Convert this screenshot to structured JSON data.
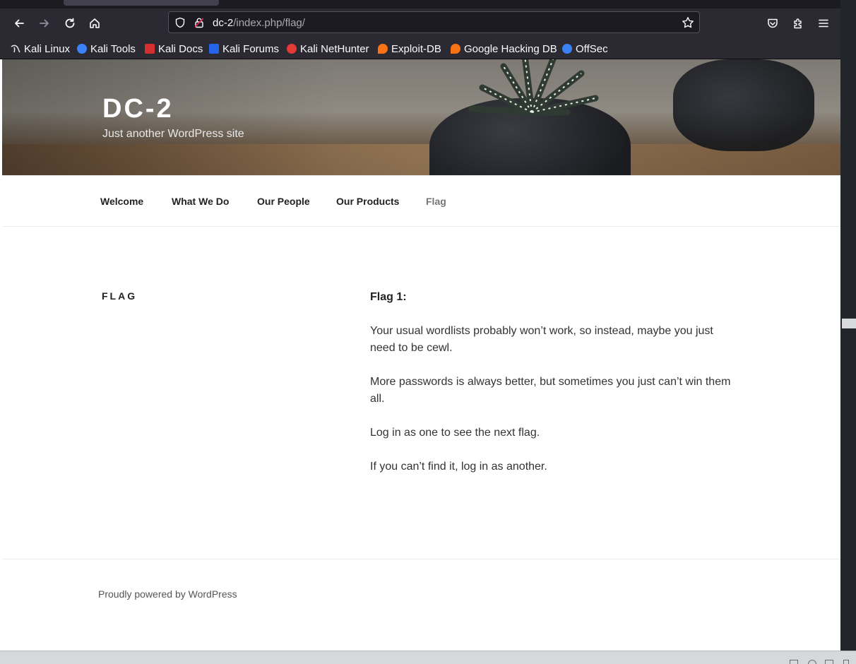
{
  "browser": {
    "url_host": "dc-2",
    "url_path": "/index.php/flag/",
    "bookmarks": [
      {
        "label": "Kali Linux",
        "icon": "kali-dragon-icon",
        "color": "#ffffff"
      },
      {
        "label": "Kali Tools",
        "icon": "kali-tools-icon",
        "color": "#3b82f6"
      },
      {
        "label": "Kali Docs",
        "icon": "kali-docs-icon",
        "color": "#d32f2f"
      },
      {
        "label": "Kali Forums",
        "icon": "kali-forums-icon",
        "color": "#2563eb"
      },
      {
        "label": "Kali NetHunter",
        "icon": "kali-nethunter-icon",
        "color": "#e53935"
      },
      {
        "label": "Exploit-DB",
        "icon": "exploit-db-icon",
        "color": "#f97316"
      },
      {
        "label": "Google Hacking DB",
        "icon": "ghdb-icon",
        "color": "#f97316"
      },
      {
        "label": "OffSec",
        "icon": "offsec-icon",
        "color": "#3b82f6"
      }
    ]
  },
  "site": {
    "title": "DC-2",
    "description": "Just another WordPress site"
  },
  "menu": [
    "Welcome",
    "What We Do",
    "Our People",
    "Our Products",
    "Flag"
  ],
  "page": {
    "title": "FLAG",
    "paragraphs": [
      "Flag 1:",
      "Your usual wordlists probably won’t work, so instead, maybe you just need to be cewl.",
      "More passwords is always better, but sometimes you just can’t win them all.",
      "Log in as one to see the next flag.",
      "If you can’t find it, log in as another."
    ]
  },
  "footer": {
    "text": "Proudly powered by WordPress"
  }
}
